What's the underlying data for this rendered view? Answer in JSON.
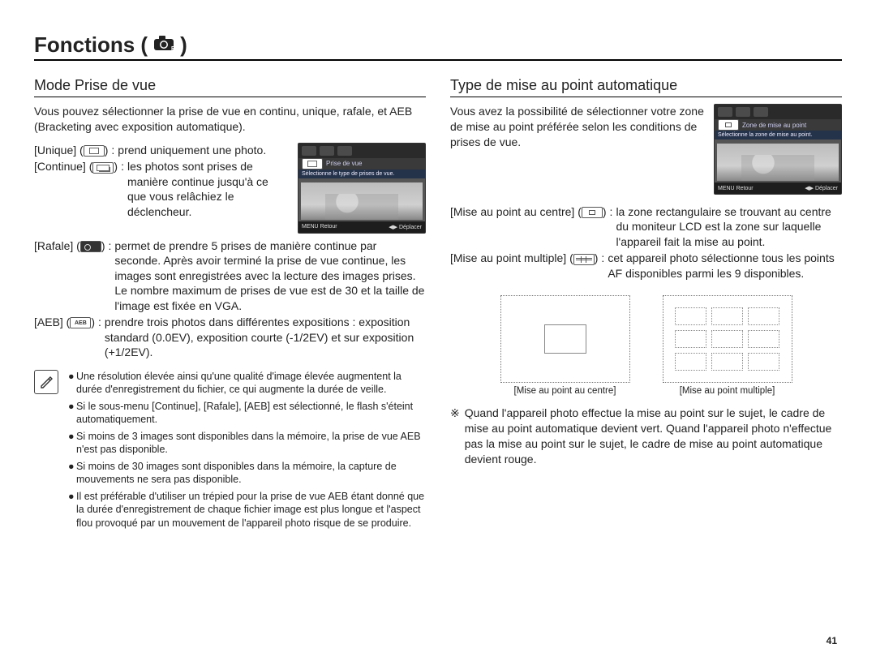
{
  "page_title": "Fonctions (",
  "page_title_suffix": ")",
  "page_number": "41",
  "left": {
    "heading": "Mode Prise de vue",
    "intro": "Vous pouvez sélectionner la prise de vue en continu, unique, rafale, et AEB (Bracketing avec exposition automatique).",
    "screen": {
      "title": "Prise de vue",
      "hint": "Sélectionne le type de prises de vue.",
      "foot_left": "Retour",
      "foot_right": "Déplacer"
    },
    "defs": [
      {
        "term": "[Unique]",
        "desc": "prend uniquement une photo."
      },
      {
        "term": "[Continue]",
        "desc": "les photos sont prises de manière continue jusqu'à ce que vous relâchiez le déclencheur."
      },
      {
        "term": "[Rafale]",
        "desc": "permet de prendre 5 prises de manière continue par seconde. Après avoir terminé la prise de vue continue, les images sont enregistrées avec la lecture des images prises. Le nombre maximum de prises de vue est de 30 et la taille de l'image est fixée en VGA."
      },
      {
        "term": "[AEB]",
        "desc": "prendre trois photos dans différentes expositions : exposition standard (0.0EV), exposition courte (-1/2EV) et sur exposition (+1/2EV)."
      }
    ],
    "notes": [
      "Une résolution élevée ainsi qu'une qualité d'image élevée augmentent la durée d'enregistrement du fichier, ce qui augmente la durée de veille.",
      "Si le sous-menu [Continue], [Rafale], [AEB] est sélectionné, le flash s'éteint automatiquement.",
      "Si moins de 3 images sont disponibles dans la mémoire, la prise de vue AEB n'est pas disponible.",
      "Si moins de 30 images sont disponibles dans la mémoire, la capture de mouvements ne sera pas disponible.",
      "Il est préférable d'utiliser un trépied pour la prise de vue AEB étant donné que la durée d'enregistrement de chaque fichier image est plus longue et l'aspect flou provoqué par un mouvement de l'appareil photo risque de se produire."
    ]
  },
  "right": {
    "heading": "Type de mise au point automatique",
    "intro": "Vous avez la possibilité de sélectionner votre zone de mise au point préférée selon les conditions de prises de vue.",
    "screen": {
      "title": "Zone de mise au point",
      "hint": "Sélectionne la zone de mise au point.",
      "foot_left": "Retour",
      "foot_right": "Déplacer"
    },
    "defs": [
      {
        "term": "[Mise au point au centre]",
        "desc": "la zone rectangulaire se trouvant au centre du moniteur LCD est la zone sur laquelle l'appareil fait la mise au point."
      },
      {
        "term": "[Mise au point multiple]",
        "desc": "cet appareil photo sélectionne tous les points AF disponibles parmi les 9 disponibles."
      }
    ],
    "diagram_captions": {
      "center": "[Mise au point au centre]",
      "multi": "[Mise au point multiple]"
    },
    "star_note": "Quand l'appareil photo effectue la mise au point sur le sujet, le cadre de mise au point automatique devient vert. Quand l'appareil photo n'effectue pas la mise au point sur le sujet, le cadre de mise au point automatique devient rouge."
  }
}
